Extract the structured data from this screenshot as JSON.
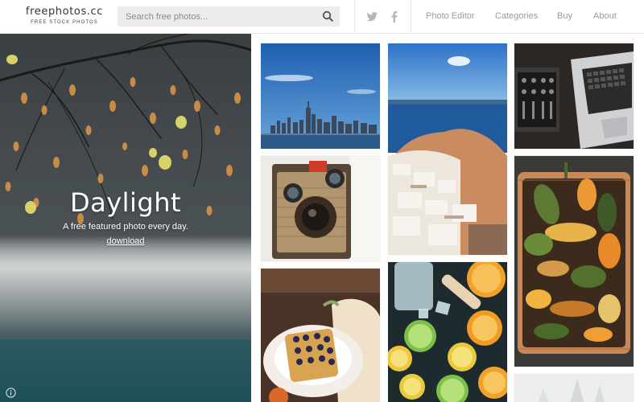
{
  "logo": {
    "title": "freephotos.cc",
    "subtitle": "FREE STOCK PHOTOS"
  },
  "search": {
    "placeholder": "Search free photos...",
    "icon": "search-icon"
  },
  "social": [
    {
      "icon": "twitter-icon"
    },
    {
      "icon": "facebook-icon"
    }
  ],
  "nav": {
    "items": [
      {
        "label": "Photo Editor"
      },
      {
        "label": "Categories"
      },
      {
        "label": "Buy"
      },
      {
        "label": "About"
      }
    ]
  },
  "hero": {
    "title": "Daylight",
    "subtitle": "A free featured photo every day.",
    "link": "download",
    "info_icon": "info-icon"
  },
  "photos": [
    {
      "subject": "city skyline across water"
    },
    {
      "subject": "santorini coastline"
    },
    {
      "subject": "laptop and audio mixer"
    },
    {
      "subject": "vintage camera"
    },
    {
      "subject": "basket of squash and gourds"
    },
    {
      "subject": "waffle on plate"
    },
    {
      "subject": "citrus slices and ice"
    },
    {
      "subject": "snowy trees"
    }
  ],
  "colors": {
    "nav_text": "#9a9a9a",
    "search_bg": "#ececec",
    "border": "#e6e6e6"
  }
}
